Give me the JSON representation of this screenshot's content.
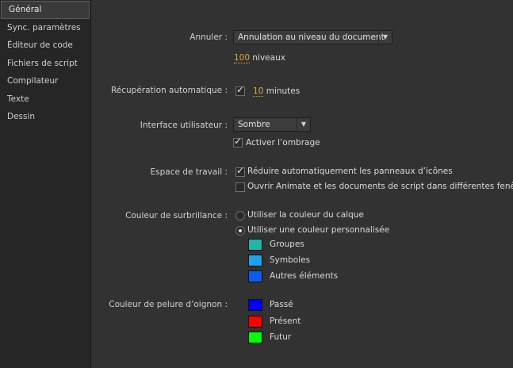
{
  "sidebar": {
    "items": [
      {
        "label": "Général"
      },
      {
        "label": "Sync. paramètres"
      },
      {
        "label": "Éditeur de code"
      },
      {
        "label": "Fichiers de script"
      },
      {
        "label": "Compilateur"
      },
      {
        "label": "Texte"
      },
      {
        "label": "Dessin"
      }
    ]
  },
  "undo": {
    "label": "Annuler :",
    "mode": "Annulation au niveau du document",
    "levels_value": "100",
    "levels_unit": "niveaux"
  },
  "autorecovery": {
    "label": "Récupération automatique :",
    "checked": true,
    "minutes_value": "10",
    "minutes_unit": "minutes"
  },
  "ui": {
    "label": "Interface utilisateur :",
    "theme": "Sombre",
    "shading_label": "Activer l’ombrage",
    "shading_checked": true
  },
  "workspace": {
    "label": "Espace de travail :",
    "auto_collapse_label": "Réduire automatiquement les panneaux d’icônes",
    "auto_collapse_checked": true,
    "separate_windows_label": "Ouvrir Animate et les documents de script dans différentes fenêtres",
    "separate_windows_checked": false
  },
  "highlight": {
    "label": "Couleur de surbrillance :",
    "layer_color_label": "Utiliser la couleur du calque",
    "custom_color_label": "Utiliser une couleur personnalisée",
    "selected": "custom",
    "colors": [
      {
        "label": "Groupes",
        "color": "#1fb5ad"
      },
      {
        "label": "Symboles",
        "color": "#1fa2f0"
      },
      {
        "label": "Autres éléments",
        "color": "#0c5cf0"
      }
    ]
  },
  "onion": {
    "label": "Couleur de pelure d’oignon :",
    "colors": [
      {
        "label": "Passé",
        "color": "#0000ff"
      },
      {
        "label": "Présent",
        "color": "#ff0000"
      },
      {
        "label": "Futur",
        "color": "#00ff00"
      }
    ]
  }
}
